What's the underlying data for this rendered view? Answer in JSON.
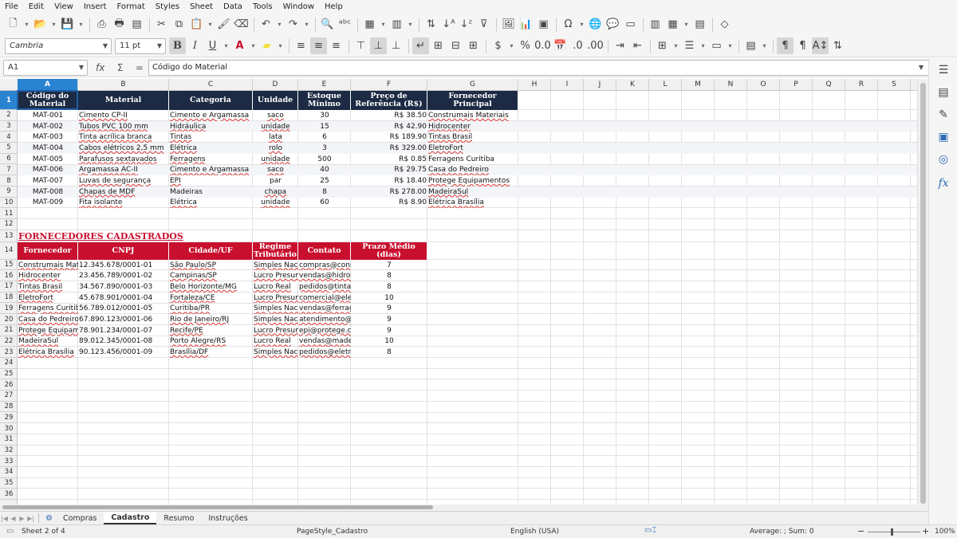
{
  "menu": [
    "File",
    "Edit",
    "View",
    "Insert",
    "Format",
    "Styles",
    "Sheet",
    "Data",
    "Tools",
    "Window",
    "Help"
  ],
  "toolbar": {
    "font_name": "Cambria",
    "font_size": "11 pt",
    "icons_row1": [
      "new-icon",
      "open-icon",
      "save-icon",
      "export-pdf-icon",
      "print-icon",
      "print-preview-icon",
      "cut-icon",
      "copy-icon",
      "paste-icon",
      "clone-format-icon",
      "clear-format-icon",
      "undo-icon",
      "redo-icon",
      "find-replace-icon",
      "spellcheck-icon",
      "row-icon",
      "column-icon",
      "sort-icon",
      "sort-ascending-icon",
      "sort-descending-icon",
      "autofilter-icon",
      "image-icon",
      "chart-icon",
      "pivot-table-icon",
      "special-character-icon",
      "hyperlink-icon",
      "comment-icon",
      "header-footer-icon",
      "define-print-area-icon",
      "freeze-icon",
      "split-window-icon",
      "show-draw-functions-icon"
    ],
    "icons_row2": [
      "bold-icon",
      "italic-icon",
      "underline-icon",
      "font-color-icon",
      "highlight-icon",
      "align-left-icon",
      "align-center-icon",
      "align-right-icon",
      "align-top-icon",
      "align-middle-icon",
      "align-bottom-icon",
      "wrap-text-icon",
      "merge-center-icon",
      "merge-icon",
      "unmerge-icon",
      "currency-icon",
      "percent-icon",
      "number-icon",
      "date-icon",
      "add-decimal-icon",
      "delete-decimal-icon",
      "increase-indent-icon",
      "decrease-indent-icon",
      "borders-icon",
      "border-style-icon",
      "border-color-icon",
      "conditional-icon",
      "ltr-icon",
      "rtl-icon",
      "text-direction-icon",
      "vertical-text-icon"
    ]
  },
  "formula_bar": {
    "cell_ref": "A1",
    "fx": "fx",
    "sigma": "Σ",
    "equals": "=",
    "content": "Código do Material"
  },
  "columns": [
    "A",
    "B",
    "C",
    "D",
    "E",
    "F",
    "G",
    "H",
    "I",
    "J",
    "K",
    "L",
    "M",
    "N",
    "O",
    "P",
    "Q",
    "R",
    "S"
  ],
  "row_numbers": [
    "1",
    "2",
    "3",
    "4",
    "5",
    "6",
    "7",
    "8",
    "9",
    "10",
    "11",
    "12",
    "13",
    "14",
    "15",
    "16",
    "17",
    "18",
    "19",
    "20",
    "21",
    "22",
    "23",
    "24",
    "25",
    "26",
    "27",
    "28",
    "29",
    "30",
    "31",
    "32",
    "33",
    "34",
    "35",
    "36"
  ],
  "materials": {
    "headers": [
      "Código do Material",
      "Material",
      "Categoria",
      "Unidade",
      "Estoque Mínimo",
      "Preço de Referência (R$)",
      "Fornecedor Principal"
    ],
    "rows": [
      [
        "MAT-001",
        "Cimento CP-II",
        "Cimento e Argamassa",
        "saco",
        "30",
        "R$ 38.50",
        "Construmais Materiais"
      ],
      [
        "MAT-002",
        "Tubos PVC 100 mm",
        "Hidráulica",
        "unidade",
        "15",
        "R$ 42.90",
        "Hidrocenter"
      ],
      [
        "MAT-003",
        "Tinta acrílica branca",
        "Tintas",
        "lata",
        "6",
        "R$ 189.90",
        "Tintas Brasil"
      ],
      [
        "MAT-004",
        "Cabos elétricos 2,5 mm",
        "Elétrica",
        "rolo",
        "3",
        "R$ 329.00",
        "EletroFort"
      ],
      [
        "MAT-005",
        "Parafusos sextavados",
        "Ferragens",
        "unidade",
        "500",
        "R$ 0.85",
        "Ferragens Curitiba"
      ],
      [
        "MAT-006",
        "Argamassa AC-II",
        "Cimento e Argamassa",
        "saco",
        "40",
        "R$ 29.75",
        "Casa do Pedreiro"
      ],
      [
        "MAT-007",
        "Luvas de segurança",
        "EPI",
        "par",
        "25",
        "R$ 18.40",
        "Protege Equipamentos"
      ],
      [
        "MAT-008",
        "Chapas de MDF",
        "Madeiras",
        "chapa",
        "8",
        "R$ 278.00",
        "MadeiraSul"
      ],
      [
        "MAT-009",
        "Fita isolante",
        "Elétrica",
        "unidade",
        "60",
        "R$ 8.90",
        "Elétrica Brasília"
      ]
    ]
  },
  "suppliers": {
    "title": "FORNECEDORES CADASTRADOS",
    "headers": [
      "Fornecedor",
      "CNPJ",
      "Cidade/UF",
      "Regime Tributário",
      "Contato",
      "Prazo Médio (dias)"
    ],
    "rows": [
      [
        "Construmais Materiais",
        "12.345.678/0001-01",
        "São Paulo/SP",
        "Simples Nacional",
        "compras@construmais",
        "7"
      ],
      [
        "Hidrocenter",
        "23.456.789/0001-02",
        "Campinas/SP",
        "Lucro Presumido",
        "vendas@hidrocenter",
        "8"
      ],
      [
        "Tintas Brasil",
        "34.567.890/0001-03",
        "Belo Horizonte/MG",
        "Lucro Real",
        "pedidos@tintasbrasil",
        "8"
      ],
      [
        "EletroFort",
        "45.678.901/0001-04",
        "Fortaleza/CE",
        "Lucro Presumido",
        "comercial@eletrofort",
        "10"
      ],
      [
        "Ferragens Curitiba",
        "56.789.012/0001-05",
        "Curitiba/PR",
        "Simples Nacional",
        "vendas@ferragens",
        "9"
      ],
      [
        "Casa do Pedreiro",
        "67.890.123/0001-06",
        "Rio de Janeiro/RJ",
        "Simples Nacional",
        "atendimento@casa",
        "9"
      ],
      [
        "Protege Equipamentos",
        "78.901.234/0001-07",
        "Recife/PE",
        "Lucro Presumido",
        "epi@protege.com",
        "9"
      ],
      [
        "MadeiraSul",
        "89.012.345/0001-08",
        "Porto Alegre/RS",
        "Lucro Real",
        "vendas@madeirasul",
        "10"
      ],
      [
        "Elétrica Brasília",
        "90.123.456/0001-09",
        "Brasília/DF",
        "Simples Nacional",
        "pedidos@eletrica",
        "8"
      ]
    ]
  },
  "sheet_tabs": [
    "Compras",
    "Cadastro",
    "Resumo",
    "Instruções"
  ],
  "active_tab": "Cadastro",
  "status": {
    "sheet": "Sheet 2 of 4",
    "page_style": "PageStyle_Cadastro",
    "language": "English (USA)",
    "summary": "Average: ; Sum: 0",
    "zoom": "100%"
  },
  "colors": {
    "header_navy": "#1c2b43",
    "header_red": "#c8102e",
    "selection": "#2a83d0"
  }
}
